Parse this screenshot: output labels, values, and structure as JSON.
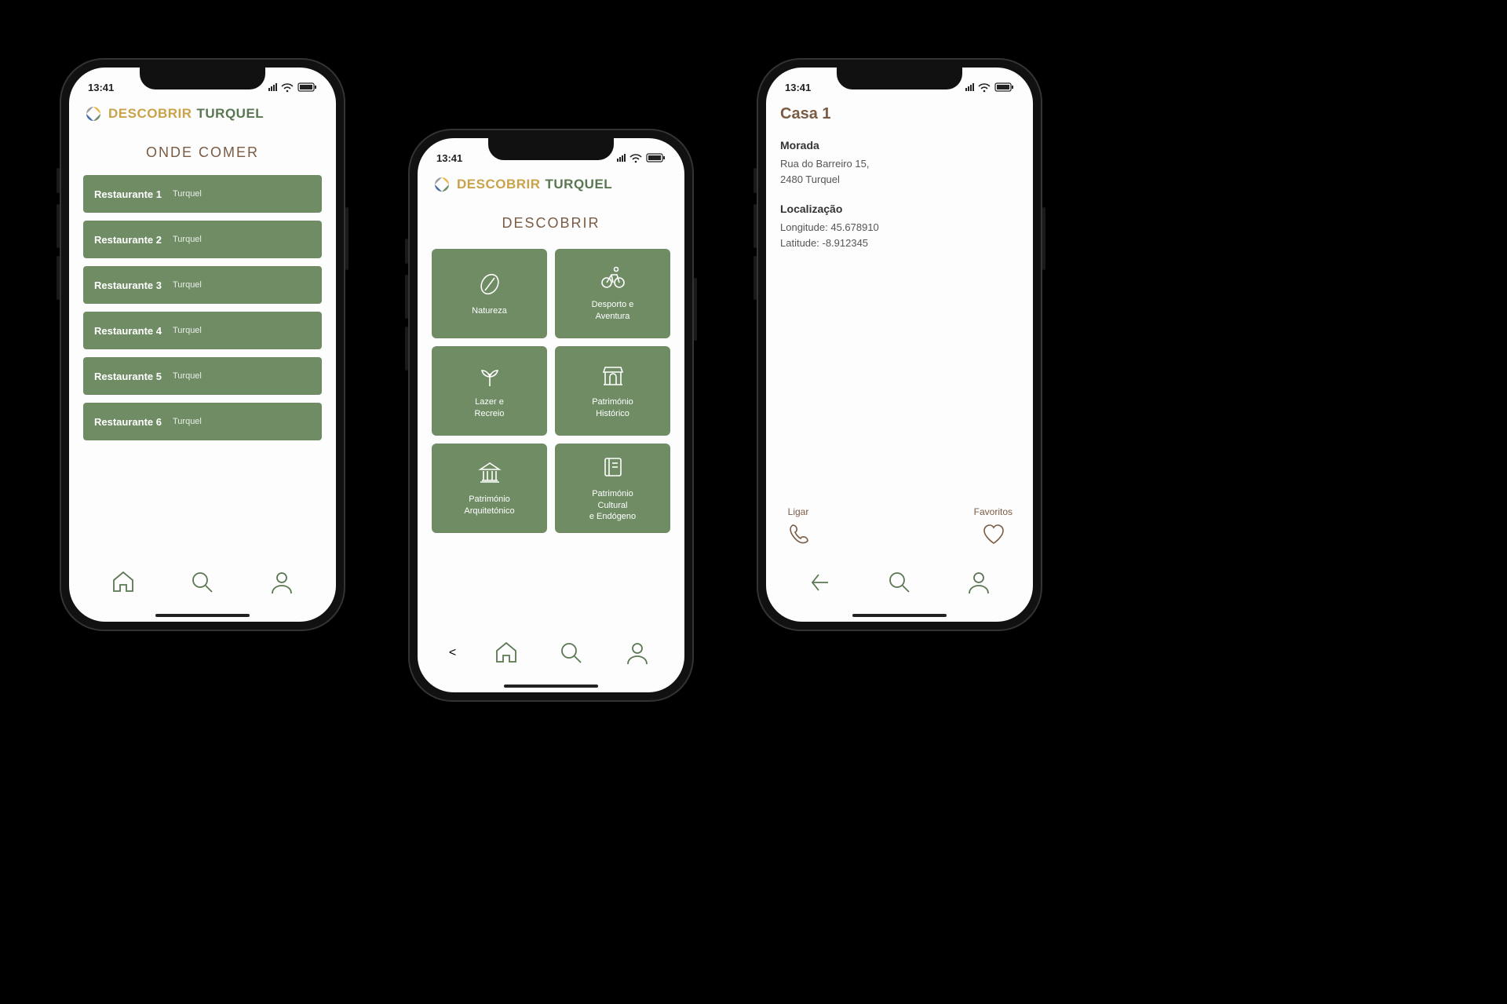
{
  "status": {
    "time": "13:41"
  },
  "brand": {
    "word1": "DESCOBRIR",
    "word2": "TURQUEL"
  },
  "screen1": {
    "title": "ONDE COMER",
    "items": [
      {
        "name": "Restaurante 1",
        "sub": "Turquel"
      },
      {
        "name": "Restaurante 2",
        "sub": "Turquel"
      },
      {
        "name": "Restaurante 3",
        "sub": "Turquel"
      },
      {
        "name": "Restaurante 4",
        "sub": "Turquel"
      },
      {
        "name": "Restaurante 5",
        "sub": "Turquel"
      },
      {
        "name": "Restaurante 6",
        "sub": "Turquel"
      }
    ]
  },
  "screen2": {
    "title": "DESCOBRIR",
    "tiles": [
      {
        "icon": "leaf",
        "label": "Natureza"
      },
      {
        "icon": "bike",
        "label": "Desporto e\nAventura"
      },
      {
        "icon": "sprout",
        "label": "Lazer e\nRecreio"
      },
      {
        "icon": "arch",
        "label": "Património\nHistórico"
      },
      {
        "icon": "columns",
        "label": "Património\nArquitetónico"
      },
      {
        "icon": "book",
        "label": "Património\nCultural\ne Endógeno"
      }
    ]
  },
  "screen3": {
    "title": "Casa 1",
    "address_h": "Morada",
    "address_l1": "Rua do Barreiro 15,",
    "address_l2": "2480 Turquel",
    "location_h": "Localização",
    "longitude": "Longitude: 45.678910",
    "latitude": "Latitude: -8.912345",
    "actions": {
      "call": "Ligar",
      "fav": "Favoritos"
    }
  },
  "nav": {
    "phone1_left": "home",
    "phone3_left": "back"
  }
}
